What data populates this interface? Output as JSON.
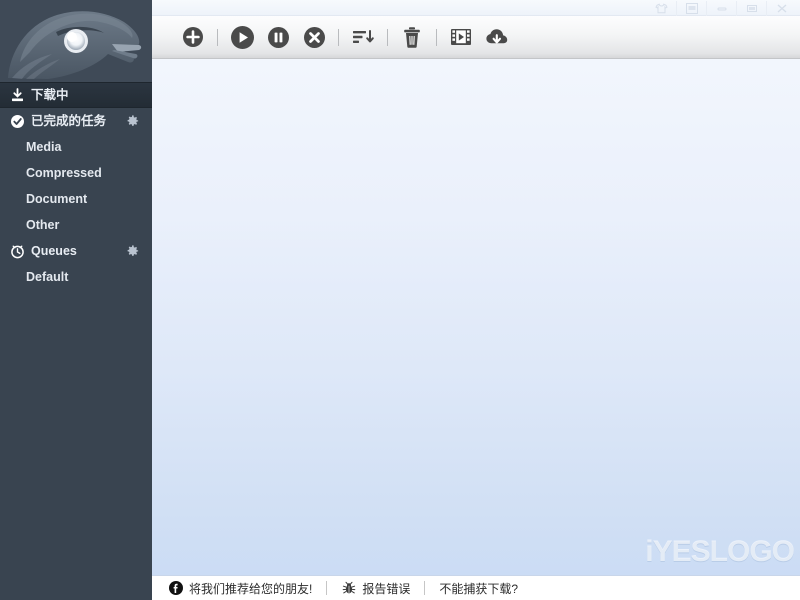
{
  "window": {
    "buttons": [
      {
        "name": "skin-button",
        "icon": "tshirt-icon",
        "title": "Skin"
      },
      {
        "name": "panel-button",
        "icon": "window-panel-icon",
        "title": "Panel"
      },
      {
        "name": "minimize-button",
        "icon": "minimize-icon",
        "title": "Minimize"
      },
      {
        "name": "maximize-button",
        "icon": "maximize-icon",
        "title": "Maximize"
      },
      {
        "name": "close-button",
        "icon": "close-icon",
        "title": "Close"
      }
    ]
  },
  "sidebar": {
    "logo_icon": "eagle-head-logo",
    "items": [
      {
        "label": "下载中",
        "icon": "download-icon",
        "selected": true,
        "gear": false,
        "sub": false
      },
      {
        "label": "已完成的任务",
        "icon": "check-circle-icon",
        "selected": false,
        "gear": true,
        "sub": false
      },
      {
        "label": "Media",
        "icon": "",
        "selected": false,
        "gear": false,
        "sub": true
      },
      {
        "label": "Compressed",
        "icon": "",
        "selected": false,
        "gear": false,
        "sub": true
      },
      {
        "label": "Document",
        "icon": "",
        "selected": false,
        "gear": false,
        "sub": true
      },
      {
        "label": "Other",
        "icon": "",
        "selected": false,
        "gear": false,
        "sub": true
      },
      {
        "label": "Queues",
        "icon": "clock-icon",
        "selected": false,
        "gear": true,
        "sub": false
      },
      {
        "label": "Default",
        "icon": "",
        "selected": false,
        "gear": false,
        "sub": true
      }
    ]
  },
  "toolbar": {
    "buttons": [
      {
        "name": "add-task-button",
        "icon": "plus-circle-icon"
      },
      {
        "name": "separator-1",
        "icon": "separator"
      },
      {
        "name": "start-button",
        "icon": "play-circle-icon"
      },
      {
        "name": "pause-button",
        "icon": "pause-circle-icon"
      },
      {
        "name": "stop-button",
        "icon": "cancel-circle-icon"
      },
      {
        "name": "separator-2",
        "icon": "separator"
      },
      {
        "name": "sort-button",
        "icon": "sort-descending-icon"
      },
      {
        "name": "separator-3",
        "icon": "separator"
      },
      {
        "name": "delete-button",
        "icon": "trash-icon"
      },
      {
        "name": "separator-4",
        "icon": "separator"
      },
      {
        "name": "video-sniffer-button",
        "icon": "film-strip-icon"
      },
      {
        "name": "download-manager-button",
        "icon": "cloud-download-icon"
      }
    ]
  },
  "main": {
    "watermark": "iYESLOGO"
  },
  "statusbar": {
    "items": [
      {
        "label": "将我们推荐给您的朋友!",
        "icon": "facebook-icon",
        "name": "recommend-link"
      },
      {
        "label": "报告错误",
        "icon": "bug-icon",
        "name": "report-bug-link"
      },
      {
        "label": "不能捕获下载?",
        "icon": "",
        "name": "cannot-capture-link"
      }
    ]
  },
  "colors": {
    "sidebar_bg": "#394450",
    "sidebar_selected": "#273039",
    "main_top": "#f2f6fd",
    "main_bottom": "#cbdcf5",
    "icon_dark": "#4a4a4a",
    "text_light": "#e8edf3"
  }
}
